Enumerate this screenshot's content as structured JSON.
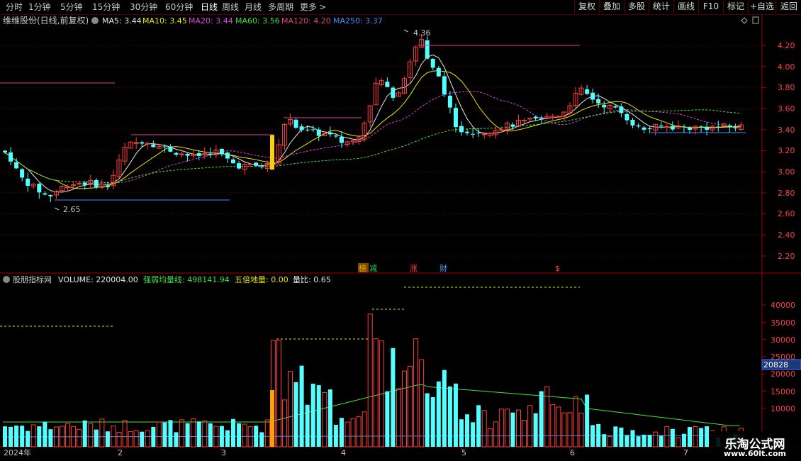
{
  "nav": {
    "periods": [
      "分时",
      "1分钟",
      "5分钟",
      "15分钟",
      "30分钟",
      "60分钟",
      "日线",
      "周线",
      "月线",
      "多周期",
      "更多"
    ],
    "active_period": "日线",
    "right_buttons": [
      "复权",
      "叠加",
      "多股",
      "统计",
      "画线",
      "F10",
      "标记",
      "+自选",
      "返回"
    ]
  },
  "main_panel": {
    "stock_label": "维维股份(日线,前复权)",
    "ma": [
      {
        "label": "MA5: 3.44",
        "color": "#e8e8e8"
      },
      {
        "label": "MA10: 3.45",
        "color": "#e8e800"
      },
      {
        "label": "MA20: 3.44",
        "color": "#e040e0"
      },
      {
        "label": "MA60: 3.56",
        "color": "#40e040"
      },
      {
        "label": "MA120: 4.20",
        "color": "#e0407a"
      },
      {
        "label": "MA250: 3.37",
        "color": "#4090ff"
      }
    ],
    "high_annotation": "4.36",
    "low_annotation": "2.65",
    "price_axis": [
      "4.20",
      "4.00",
      "3.80",
      "3.60",
      "3.40",
      "3.20",
      "3.00",
      "2.80",
      "2.60",
      "2.40",
      "2.20"
    ],
    "event_tags": [
      {
        "text": "榜",
        "color": "#e8a000",
        "bg": "#7a4a00"
      },
      {
        "text": "减",
        "color": "#20d060",
        "bg": ""
      },
      {
        "text": "涨",
        "color": "#ff4040",
        "bg": ""
      },
      {
        "text": "财",
        "color": "#40a0ff",
        "bg": ""
      },
      {
        "text": "$",
        "color": "#ff4040",
        "bg": ""
      }
    ]
  },
  "volume_panel": {
    "indicator_title": "股朋指标网",
    "values": [
      {
        "label": "VOLUME: 220004.00",
        "color": "#e8e8e8"
      },
      {
        "label": "强弱均量线: 498141.94",
        "color": "#40e040"
      },
      {
        "label": "五倍地量: 0.00",
        "color": "#e8e800"
      },
      {
        "label": "量比: 0.65",
        "color": "#e8e8e8"
      }
    ],
    "axis": [
      "40000",
      "35000",
      "30000",
      "25000",
      "20000",
      "15000",
      "10000"
    ],
    "crosshair_value": "20828"
  },
  "date_axis": [
    "2024年",
    "2",
    "3",
    "4",
    "5",
    "6",
    "7"
  ],
  "watermark": {
    "name": "乐淘公式网",
    "url": "www.60lt.com"
  },
  "colors": {
    "up": "#ff3c3c",
    "down": "#54ffff",
    "grid": "#7a0000"
  }
}
